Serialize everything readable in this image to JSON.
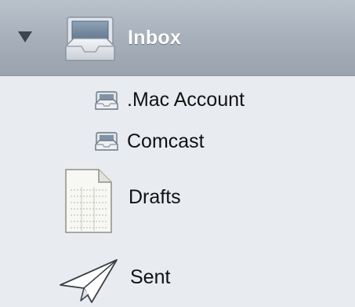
{
  "mailboxes": {
    "inbox": {
      "label": "Inbox",
      "expanded": true,
      "selected": true
    },
    "accounts": [
      {
        "label": ".Mac Account"
      },
      {
        "label": "Comcast"
      }
    ],
    "drafts": {
      "label": "Drafts"
    },
    "sent": {
      "label": "Sent"
    }
  },
  "colors": {
    "background": "#e8ecf1",
    "selection": "#a6afb9",
    "selected_text": "#ffffff",
    "text": "#111111"
  },
  "icons": {
    "disclosure": "disclosure-triangle-icon",
    "inbox": "inbox-tray-icon",
    "account": "account-inbox-icon",
    "drafts": "draft-document-icon",
    "sent": "paper-plane-icon"
  }
}
